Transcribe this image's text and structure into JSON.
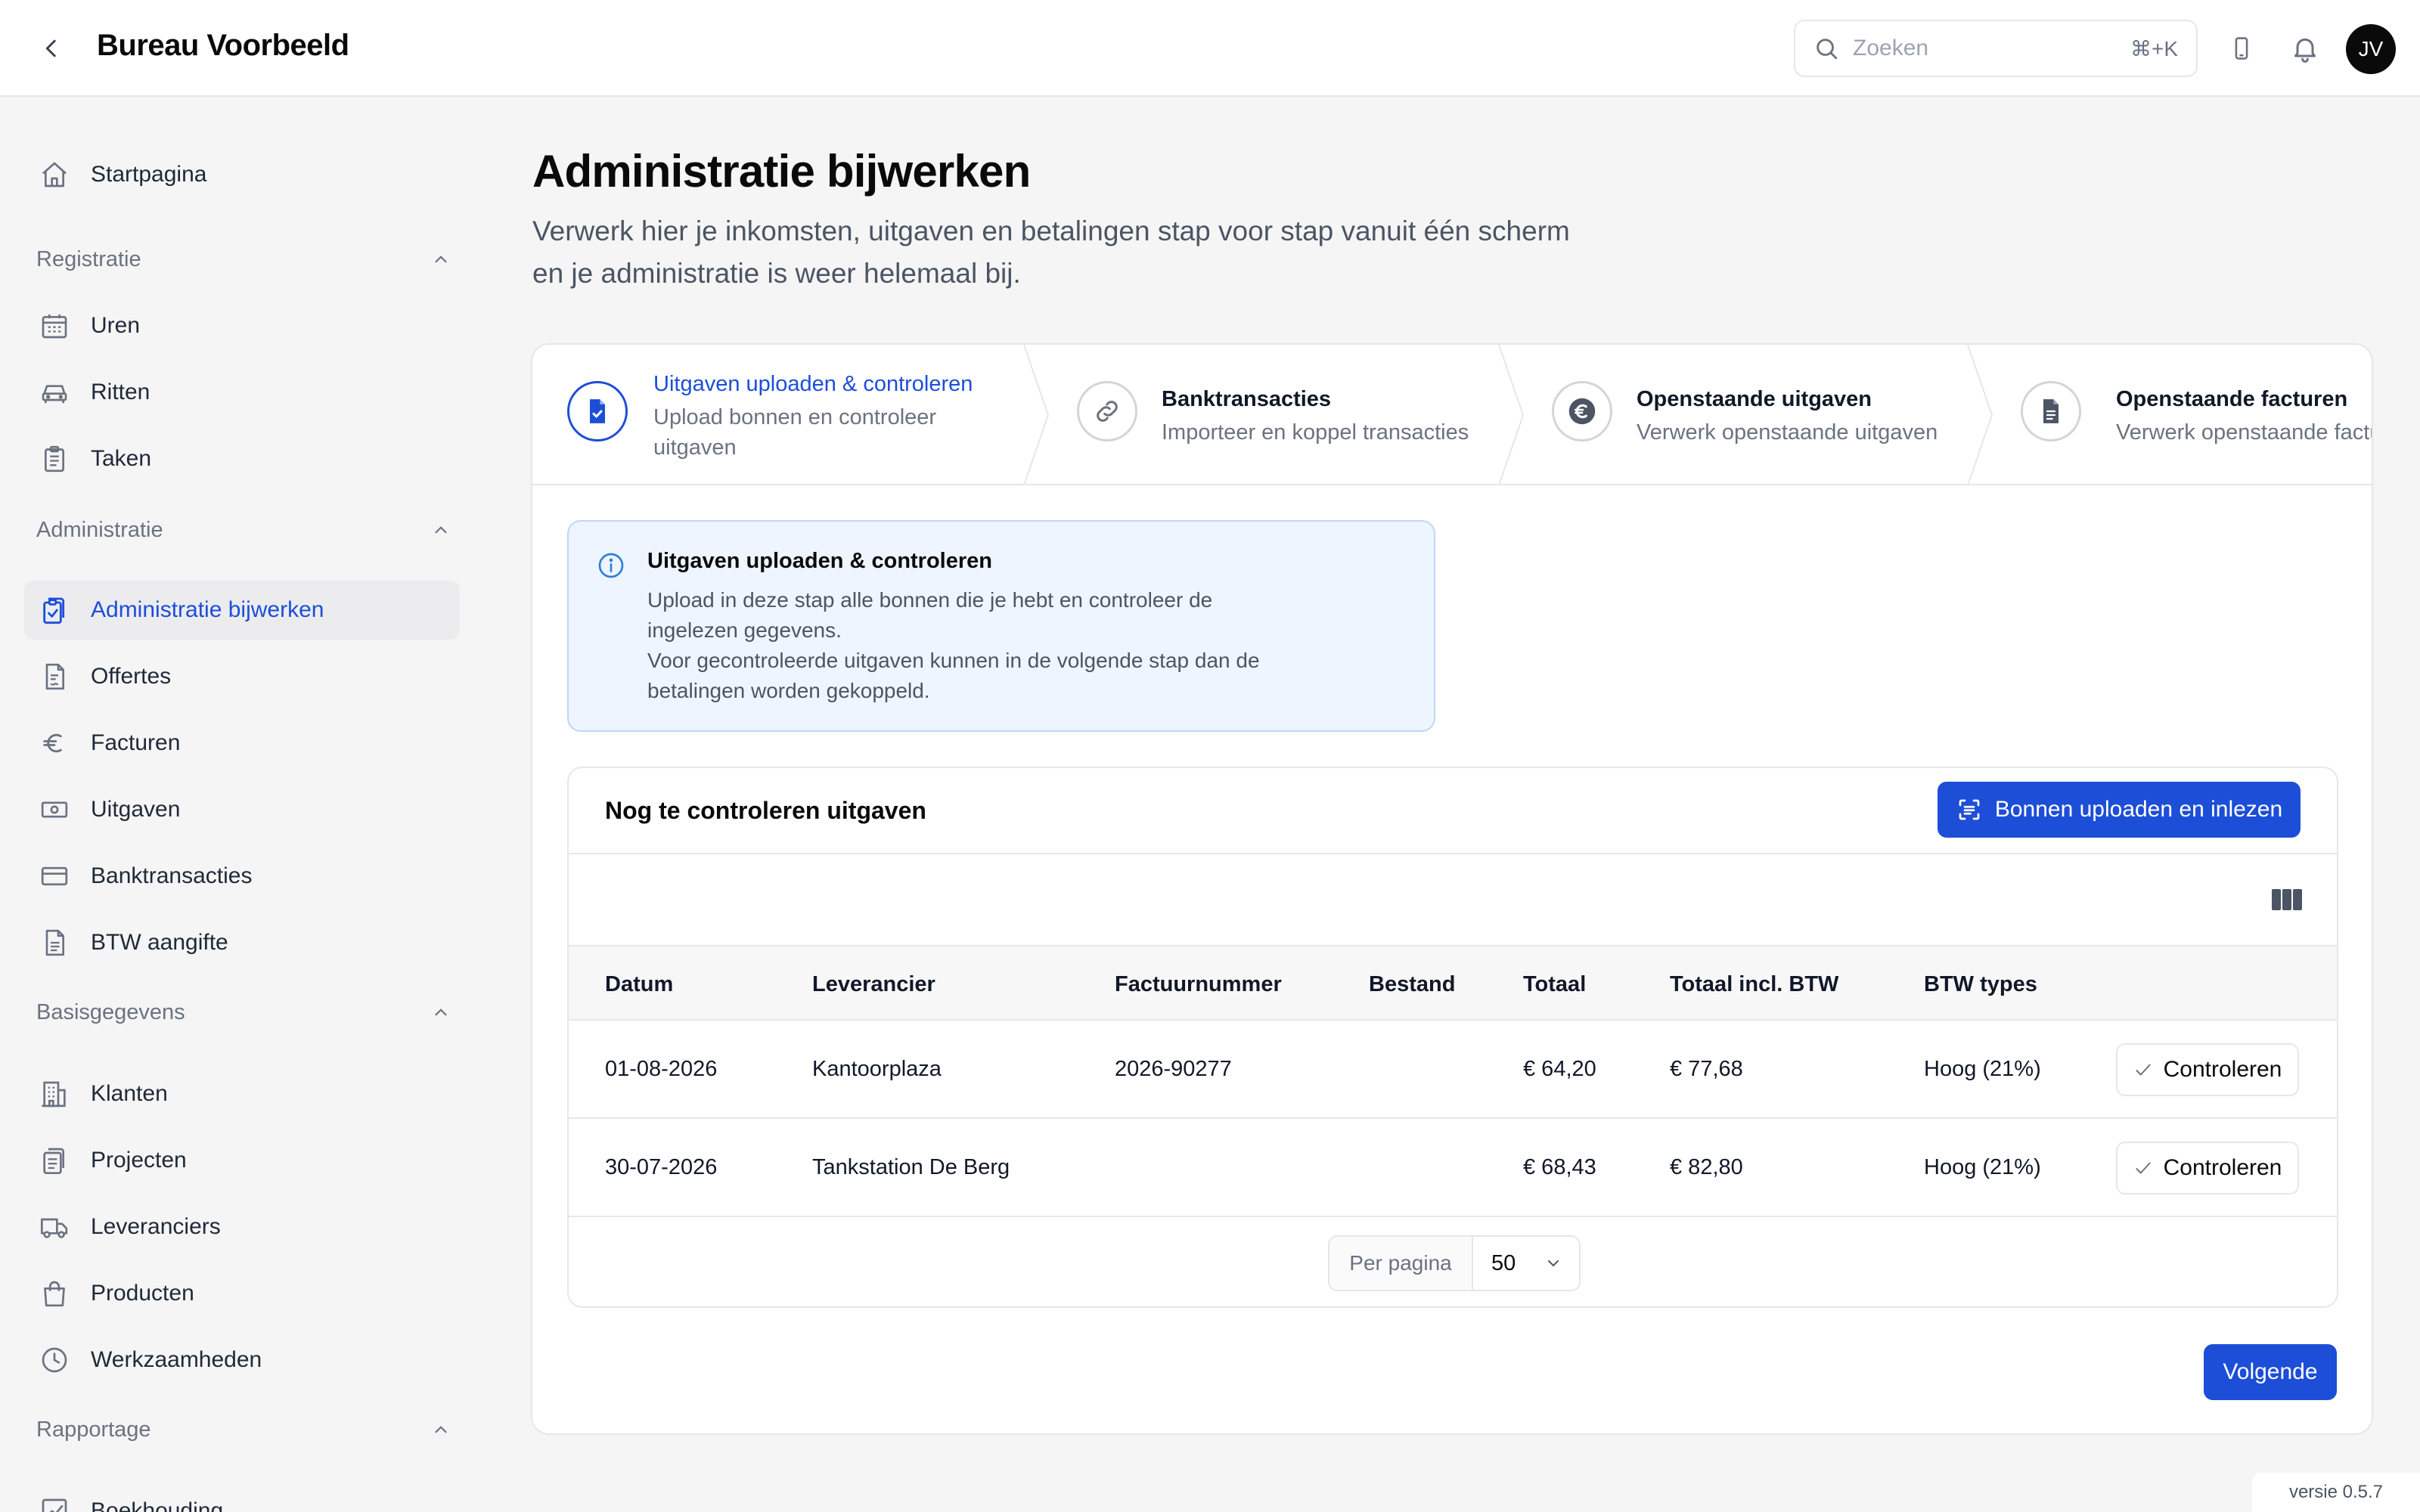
{
  "header": {
    "title": "Bureau Voorbeeld",
    "search_placeholder": "Zoeken",
    "search_shortcut": "⌘+K",
    "avatar_initials": "JV"
  },
  "sidebar": {
    "home": "Startpagina",
    "sections": [
      {
        "label": "Registratie",
        "items": [
          "Uren",
          "Ritten",
          "Taken"
        ]
      },
      {
        "label": "Administratie",
        "items": [
          "Administratie bijwerken",
          "Offertes",
          "Facturen",
          "Uitgaven",
          "Banktransacties",
          "BTW aangifte"
        ]
      },
      {
        "label": "Basisgegevens",
        "items": [
          "Klanten",
          "Projecten",
          "Leveranciers",
          "Producten",
          "Werkzaamheden"
        ]
      },
      {
        "label": "Rapportage",
        "items": [
          "Boekhouding"
        ]
      }
    ],
    "active_item": "Administratie bijwerken"
  },
  "page": {
    "title": "Administratie bijwerken",
    "subtitle": "Verwerk hier je inkomsten, uitgaven en betalingen stap voor stap vanuit één scherm en je administratie is weer helemaal bij."
  },
  "steps": [
    {
      "title": "Uitgaven uploaden & controleren",
      "desc_line1": "Upload bonnen en controleer",
      "desc_line2": "uitgaven",
      "active": true
    },
    {
      "title": "Banktransacties",
      "desc_line1": "Importeer en koppel transacties",
      "active": false
    },
    {
      "title": "Openstaande uitgaven",
      "desc_line1": "Verwerk openstaande uitgaven",
      "active": false
    },
    {
      "title": "Openstaande facturen",
      "desc_line1": "Verwerk openstaande facturen",
      "active": false
    }
  ],
  "info": {
    "title": "Uitgaven uploaden & controleren",
    "line1": "Upload in deze stap alle bonnen die je hebt en controleer de",
    "line2": "ingelezen gegevens.",
    "line3": "Voor gecontroleerde uitgaven kunnen in de volgende stap dan de",
    "line4": "betalingen worden gekoppeld."
  },
  "table": {
    "title": "Nog te controleren uitgaven",
    "upload_button": "Bonnen uploaden en inlezen",
    "columns": [
      "Datum",
      "Leverancier",
      "Factuurnummer",
      "Bestand",
      "Totaal",
      "Totaal incl. BTW",
      "BTW types"
    ],
    "rows": [
      {
        "datum": "01-08-2026",
        "leverancier": "Kantoorplaza",
        "factuurnummer": "2026-90277",
        "bestand": "",
        "totaal": "€ 64,20",
        "totaal_incl": "€ 77,68",
        "btw": "Hoog (21%)",
        "action": "Controleren"
      },
      {
        "datum": "30-07-2026",
        "leverancier": "Tankstation De Berg",
        "factuurnummer": "",
        "bestand": "",
        "totaal": "€ 68,43",
        "totaal_incl": "€ 82,80",
        "btw": "Hoog (21%)",
        "action": "Controleren"
      }
    ],
    "per_page_label": "Per pagina",
    "per_page_value": "50"
  },
  "footer": {
    "next_button": "Volgende",
    "version": "versie 0.5.7"
  },
  "colors": {
    "accent": "#1d4ed8",
    "info_bg": "#eef5ff",
    "sidebar_active_bg": "#ececef"
  }
}
